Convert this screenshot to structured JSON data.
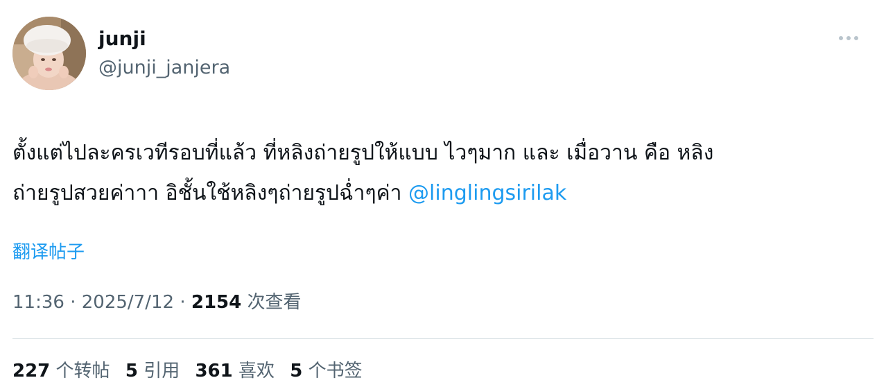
{
  "user": {
    "display_name": "junji",
    "handle": "@junji_janjera"
  },
  "tweet": {
    "text_line1": "ตั้งแต่ไปละครเวทีรอบที่แล้ว ที่หลิงถ่ายรูปให้แบบ ไวๆมาก และ เมื่อวาน คือ หลิง",
    "text_line2": "ถ่ายรูปสวยค่าาา อิชั้นใช้หลิงๆถ่ายรูปฉ่ำๆค่า",
    "mention": "@linglingsirilak"
  },
  "translate_label": "翻译帖子",
  "meta": {
    "time": "11:36",
    "separator": " · ",
    "date": "2025/7/12",
    "views_count": "2154",
    "views_label": "次查看"
  },
  "stats": {
    "retweets_count": "227",
    "retweets_label": "个转帖",
    "quotes_count": "5",
    "quotes_label": "引用",
    "likes_count": "361",
    "likes_label": "喜欢",
    "bookmarks_count": "5",
    "bookmarks_label": "个书签"
  },
  "icons": {
    "more": "more-horizontal-icon"
  },
  "colors": {
    "link": "#1d9bf0",
    "secondary_text": "#536471",
    "primary_text": "#0f1419",
    "divider": "#cfd9de"
  }
}
